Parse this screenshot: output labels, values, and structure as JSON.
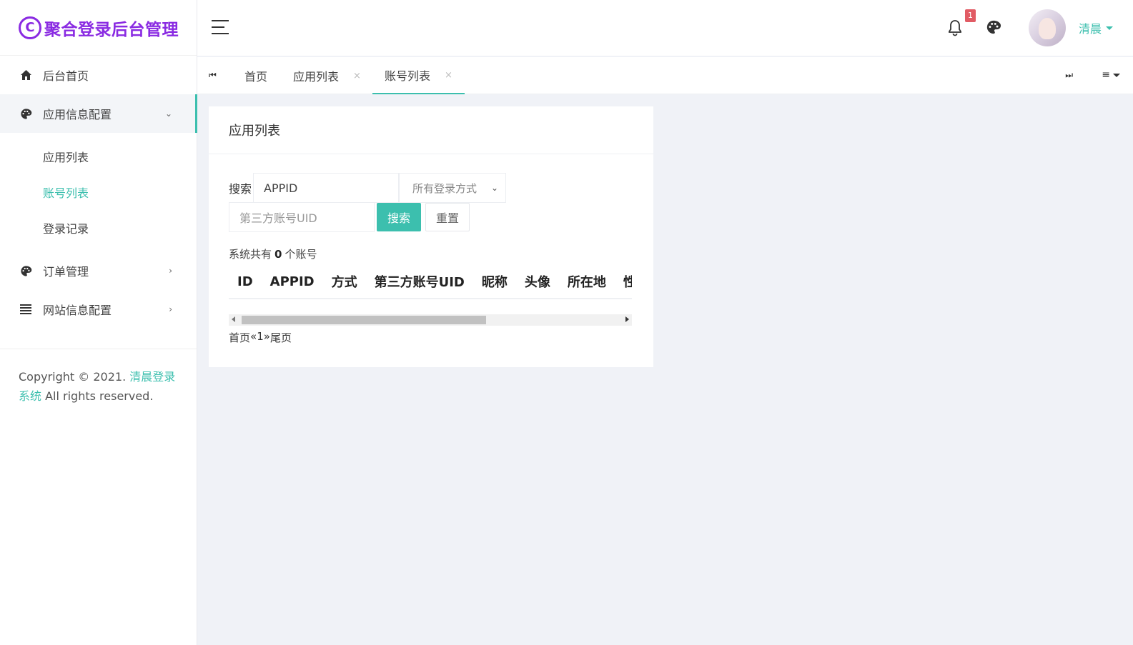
{
  "brand": {
    "logo_char": "C",
    "title": "聚合登录后台管理"
  },
  "sidebar": {
    "items": [
      {
        "label": "后台首页",
        "icon": "home-icon"
      },
      {
        "label": "应用信息配置",
        "icon": "palette-icon",
        "expanded": true,
        "children": [
          {
            "label": "应用列表"
          },
          {
            "label": "账号列表",
            "current": true
          },
          {
            "label": "登录记录"
          }
        ]
      },
      {
        "label": "订单管理",
        "icon": "palette-icon"
      },
      {
        "label": "网站信息配置",
        "icon": "list-icon"
      }
    ],
    "copyright_prefix": "Copyright © 2021. ",
    "copyright_link": "清晨登录系统",
    "copyright_suffix": " All rights reserved."
  },
  "header": {
    "notification_count": "1",
    "username": "清晨"
  },
  "tabs": [
    {
      "label": "首页",
      "closable": false
    },
    {
      "label": "应用列表",
      "closable": true
    },
    {
      "label": "账号列表",
      "closable": true,
      "active": true
    }
  ],
  "card": {
    "title": "应用列表",
    "search_label": "搜索",
    "appid_value": "APPID",
    "login_method_selected": "所有登录方式",
    "uid_placeholder": "第三方账号UID",
    "search_button": "搜索",
    "reset_button": "重置",
    "summary_prefix": "系统共有",
    "summary_count": "0",
    "summary_suffix": "个账号",
    "columns": [
      "ID",
      "APPID",
      "方式",
      "第三方账号UID",
      "昵称",
      "头像",
      "所在地",
      "性"
    ],
    "pager": [
      "首页",
      "«",
      "1",
      "»",
      "尾页"
    ]
  },
  "colors": {
    "accent": "#3cbfae",
    "brand": "#8a2be2",
    "badge": "#e15b64"
  }
}
